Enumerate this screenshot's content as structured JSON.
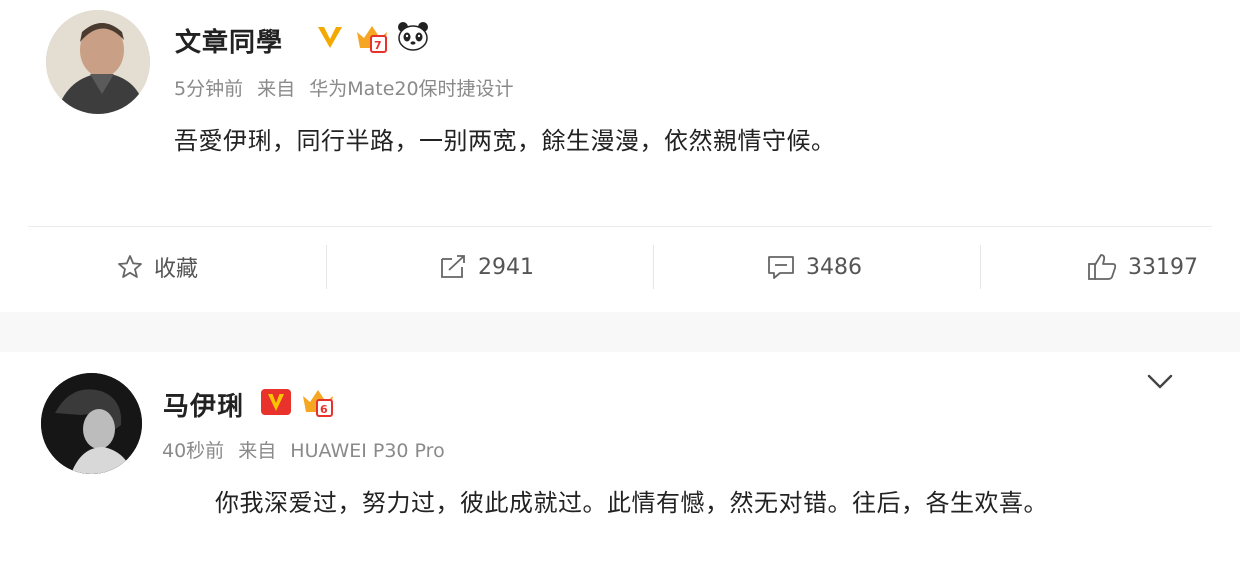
{
  "post": {
    "author": "文章同學",
    "time": "5分钟前",
    "source_prefix": "来自",
    "source": "华为Mate20保时捷设计",
    "text": "吾愛伊琍，同行半路，一别两宽，餘生漫漫，依然親情守候。"
  },
  "actions": {
    "favorite_label": "收藏",
    "repost_count": "2941",
    "comment_count": "3486",
    "like_count": "33197"
  },
  "reply": {
    "author": "马伊琍",
    "time": "40秒前",
    "source_prefix": "来自",
    "source": "HUAWEI P30 Pro",
    "text": "你我深爱过，努力过，彼此成就过。此情有憾，然无对错。往后，各生欢喜。"
  },
  "colors": {
    "verified_gold": "#f2a900",
    "verified_red": "#e8322b",
    "text_primary": "#222222",
    "text_meta": "#8a8a8a"
  }
}
